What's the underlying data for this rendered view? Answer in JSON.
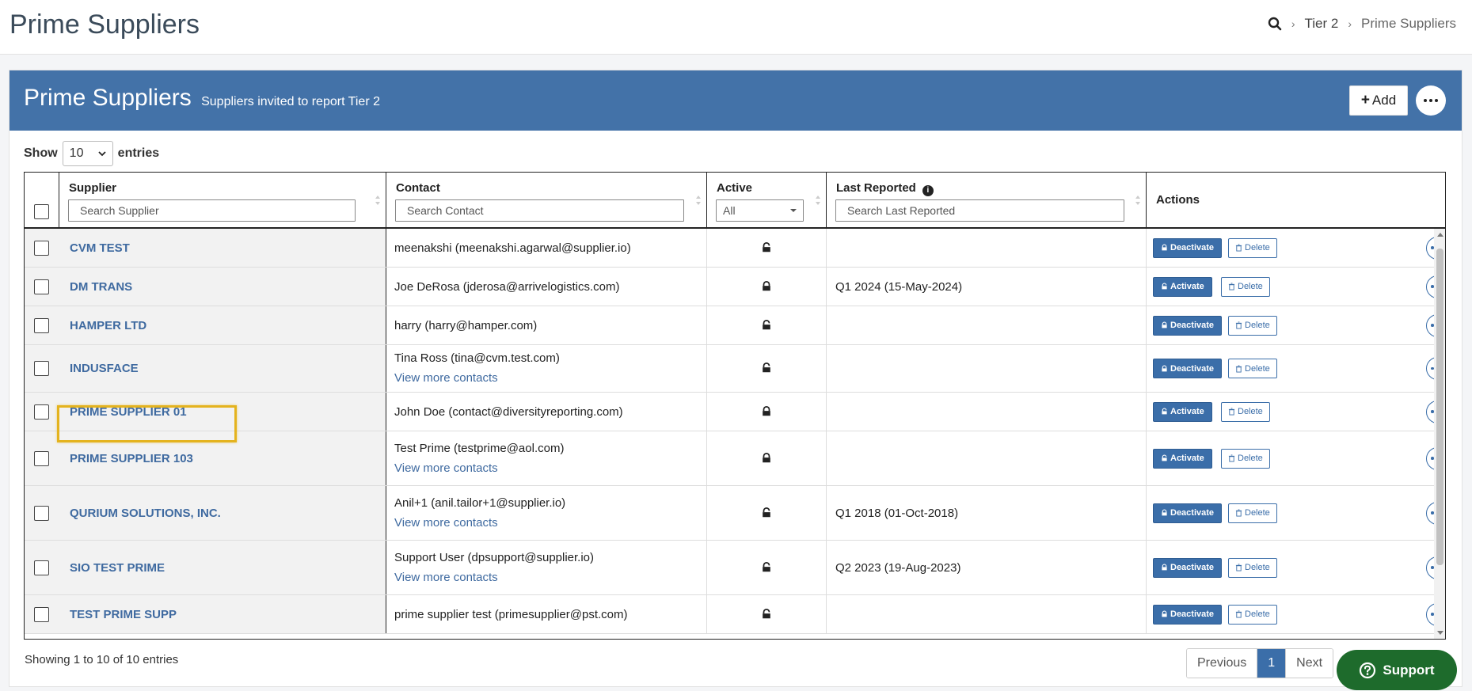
{
  "header": {
    "title": "Prime Suppliers",
    "breadcrumb": {
      "tier": "Tier 2",
      "current": "Prime Suppliers"
    }
  },
  "panel": {
    "title": "Prime Suppliers",
    "subtitle": "Suppliers invited to report Tier 2",
    "add_label": "Add"
  },
  "length": {
    "show": "Show",
    "value": "10",
    "entries": "entries"
  },
  "columns": {
    "supplier": {
      "label": "Supplier",
      "placeholder": "Search Supplier"
    },
    "contact": {
      "label": "Contact",
      "placeholder": "Search Contact"
    },
    "active": {
      "label": "Active",
      "filter": "All"
    },
    "last_reported": {
      "label": "Last Reported",
      "placeholder": "Search Last Reported"
    },
    "actions": {
      "label": "Actions"
    }
  },
  "rows": [
    {
      "supplier": "CVM TEST",
      "contact": "meenakshi (meenakshi.agarwal@supplier.io)",
      "more": "",
      "locked": false,
      "last": "",
      "action": "Deactivate",
      "delete": "Delete"
    },
    {
      "supplier": "DM TRANS",
      "contact": "Joe DeRosa (jderosa@arrivelogistics.com)",
      "more": "",
      "locked": true,
      "last": "Q1 2024 (15-May-2024)",
      "action": "Activate",
      "delete": "Delete"
    },
    {
      "supplier": "HAMPER LTD",
      "contact": "harry (harry@hamper.com)",
      "more": "",
      "locked": false,
      "last": "",
      "action": "Deactivate",
      "delete": "Delete"
    },
    {
      "supplier": "INDUSFACE",
      "contact": "Tina Ross (tina@cvm.test.com)",
      "more": "View more contacts",
      "locked": false,
      "last": "",
      "action": "Deactivate",
      "delete": "Delete"
    },
    {
      "supplier": "PRIME SUPPLIER 01",
      "contact": "John Doe (contact@diversityreporting.com)",
      "more": "",
      "locked": true,
      "last": "",
      "action": "Activate",
      "delete": "Delete"
    },
    {
      "supplier": "PRIME SUPPLIER 103",
      "contact": "Test Prime (testprime@aol.com)",
      "more": "View more contacts",
      "locked": true,
      "last": "",
      "action": "Activate",
      "delete": "Delete"
    },
    {
      "supplier": "QURIUM SOLUTIONS, INC.",
      "contact": "Anil+1 (anil.tailor+1@supplier.io)",
      "more": "View more contacts",
      "locked": false,
      "last": "Q1 2018 (01-Oct-2018)",
      "action": "Deactivate",
      "delete": "Delete"
    },
    {
      "supplier": "SIO TEST PRIME",
      "contact": "Support User (dpsupport@supplier.io)",
      "more": "View more contacts",
      "locked": false,
      "last": "Q2 2023 (19-Aug-2023)",
      "action": "Deactivate",
      "delete": "Delete"
    },
    {
      "supplier": "TEST PRIME SUPP",
      "contact": "prime supplier test (primesupplier@pst.com)",
      "more": "",
      "locked": false,
      "last": "",
      "action": "Deactivate",
      "delete": "Delete"
    }
  ],
  "footer": {
    "info": "Showing 1 to 10 of 10 entries",
    "previous": "Previous",
    "page": "1",
    "next": "Next"
  },
  "support": {
    "label": "Support"
  },
  "colors": {
    "accent": "#4372a8",
    "link": "#3f6aa0",
    "support": "#1e6b2c",
    "highlight": "#e4b31e"
  }
}
